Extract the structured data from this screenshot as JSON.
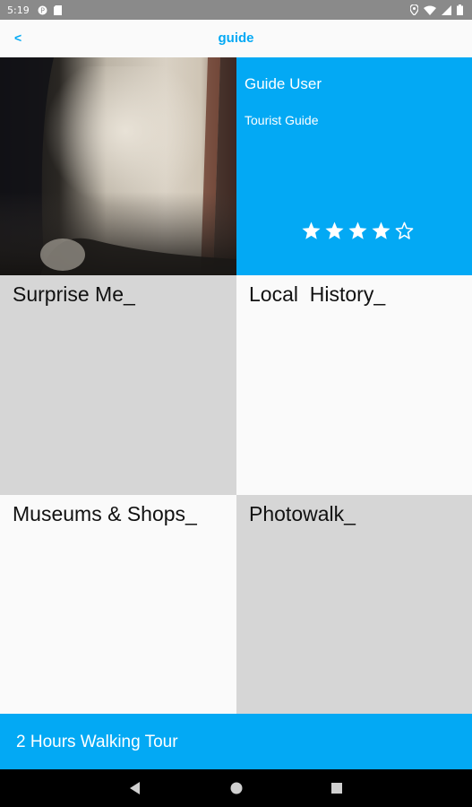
{
  "status_bar": {
    "time": "5:19",
    "left_icons": [
      "app-notification-icon",
      "sd-card-icon"
    ],
    "right_icons": [
      "location-icon",
      "wifi-icon",
      "signal-icon",
      "battery-icon"
    ]
  },
  "app_bar": {
    "back_label": "<",
    "title": "guide"
  },
  "profile": {
    "name": "Guide User",
    "role": "Tourist Guide",
    "rating": 4,
    "rating_max": 5,
    "accent_color": "#03a9f4"
  },
  "categories": [
    {
      "label": "Surprise Me_",
      "color": "#d6d6d6"
    },
    {
      "label": "Local  History_",
      "color": "#fafafa"
    },
    {
      "label": "Museums & Shops_",
      "color": "#fafafa"
    },
    {
      "label": "Photowalk_",
      "color": "#d6d6d6"
    }
  ],
  "tour_banner": {
    "label": "2 Hours Walking Tour"
  },
  "nav_bar": {
    "buttons": [
      "back-triangle-icon",
      "home-circle-icon",
      "recents-square-icon"
    ]
  }
}
